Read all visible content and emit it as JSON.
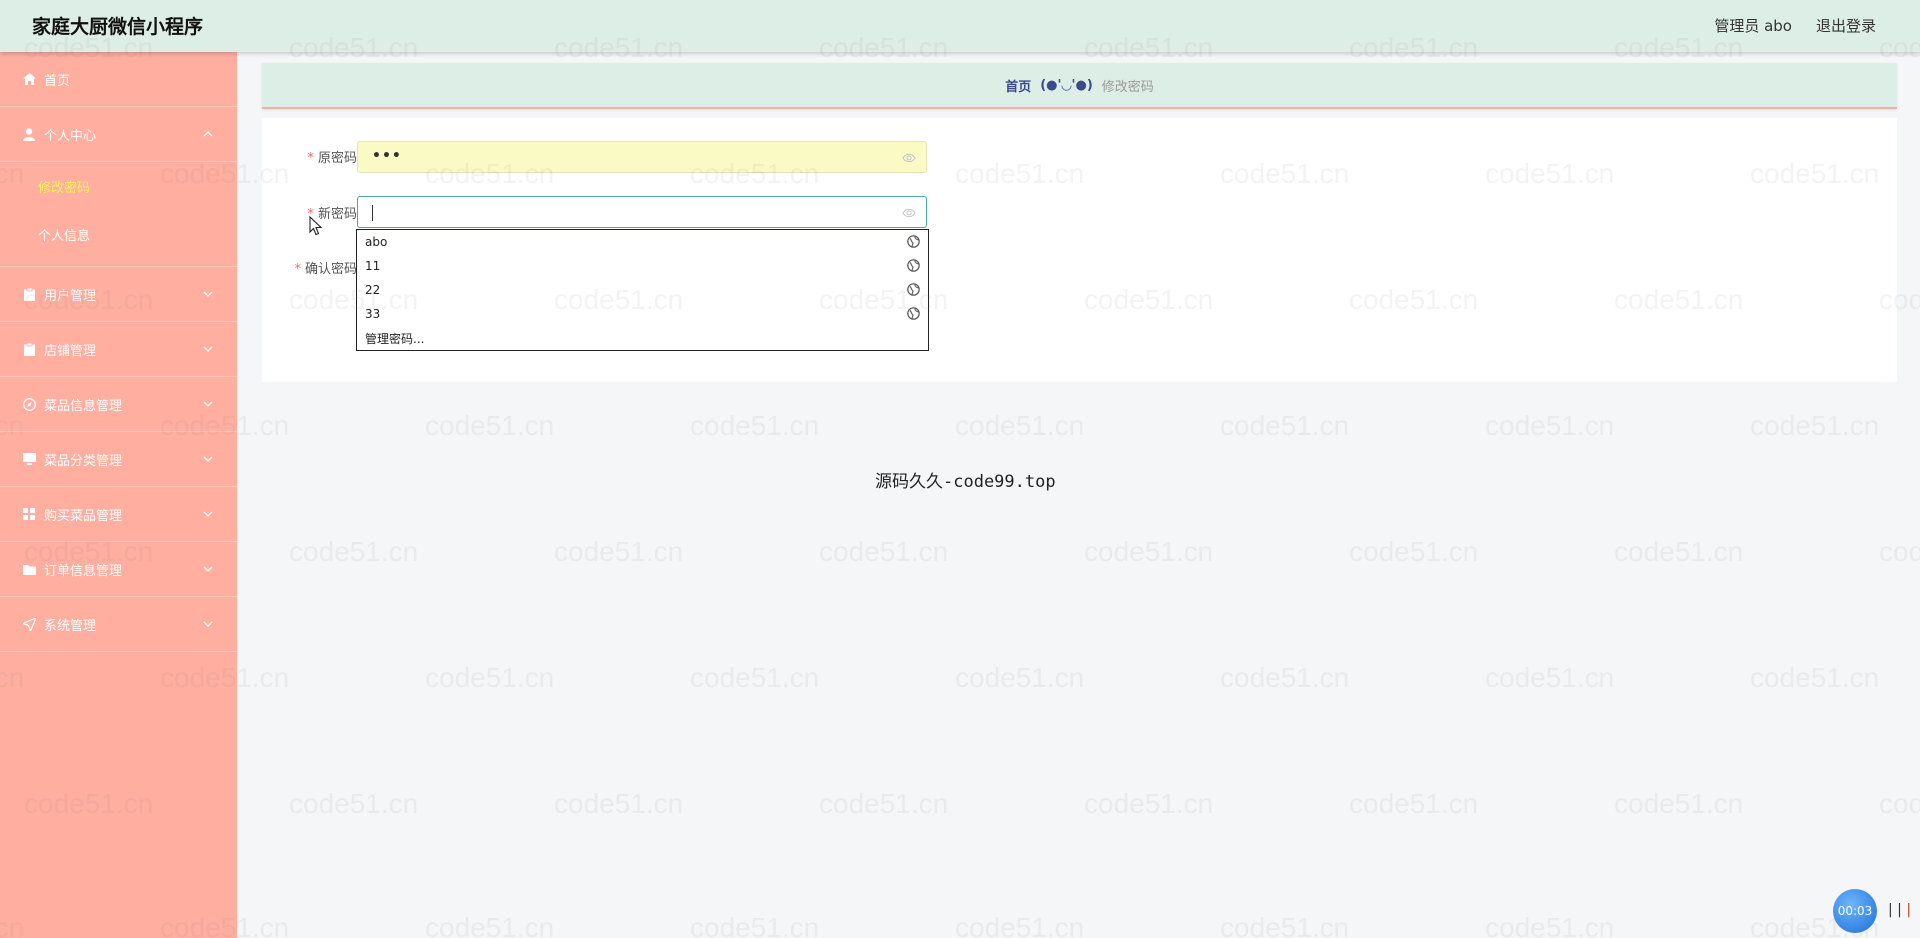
{
  "header": {
    "app_title": "家庭大厨微信小程序",
    "user_label": "管理员 abo",
    "logout_label": "退出登录"
  },
  "sidebar": {
    "items": [
      {
        "label": "首页",
        "icon": "home-icon"
      },
      {
        "label": "个人中心",
        "icon": "user-icon",
        "expanded": true,
        "children": [
          {
            "label": "修改密码",
            "active": true
          },
          {
            "label": "个人信息"
          }
        ]
      },
      {
        "label": "用户管理",
        "icon": "clipboard-icon"
      },
      {
        "label": "店铺管理",
        "icon": "clipboard-icon"
      },
      {
        "label": "菜品信息管理",
        "icon": "compass-icon"
      },
      {
        "label": "菜品分类管理",
        "icon": "monitor-icon"
      },
      {
        "label": "购买菜品管理",
        "icon": "grid-icon"
      },
      {
        "label": "订单信息管理",
        "icon": "folder-icon"
      },
      {
        "label": "系统管理",
        "icon": "send-icon"
      }
    ]
  },
  "breadcrumb": {
    "home": "首页",
    "separator": "(●'◡'●)",
    "current": "修改密码"
  },
  "form": {
    "old_password": {
      "label": "原密码",
      "value": "•••"
    },
    "new_password": {
      "label": "新密码",
      "value": ""
    },
    "confirm_password": {
      "label": "确认密码",
      "value": ""
    }
  },
  "autocomplete": {
    "options": [
      "abo",
      "11",
      "22",
      "33"
    ],
    "manage_label": "管理密码..."
  },
  "footer_text": "源码久久-code99.top",
  "watermark_text": "code51.cn",
  "timer": "00:03",
  "colors": {
    "header_bg": "#ddeee6",
    "sidebar_bg": "#ffaea0",
    "active_submenu": "#fbf35c",
    "breadcrumb_home": "#3a4a8c",
    "required_star": "#f56c6c"
  }
}
